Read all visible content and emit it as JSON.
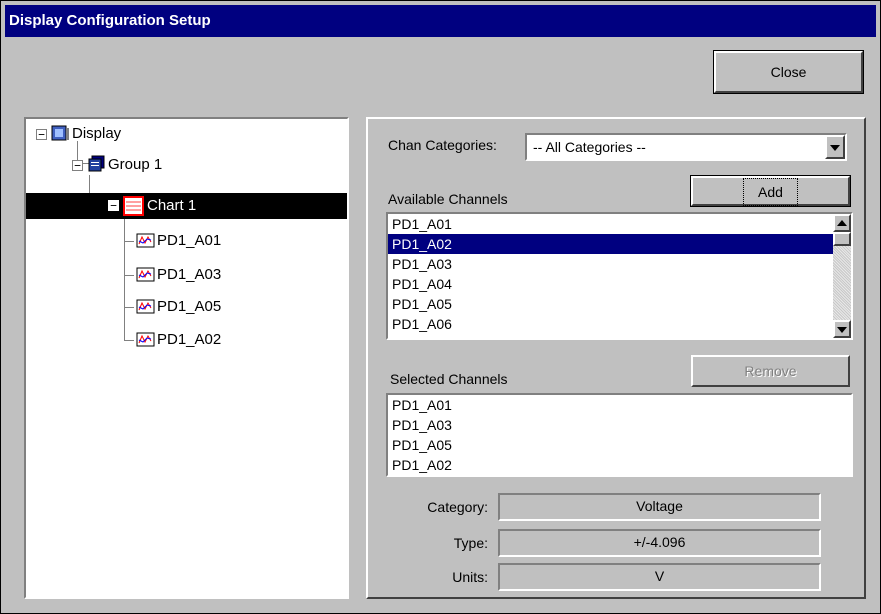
{
  "window": {
    "title": "Display Configuration Setup"
  },
  "close_button": {
    "label": "Close"
  },
  "tree": {
    "root": "Display",
    "group": "Group 1",
    "chart": "Chart 1",
    "channels": [
      "PD1_A01",
      "PD1_A03",
      "PD1_A05",
      "PD1_A02"
    ],
    "root_expander": "−",
    "group_expander": "−",
    "chart_expander": "−"
  },
  "panel": {
    "chan_categories_label": "Chan Categories:",
    "chan_categories_value": "-- All Categories --",
    "available_label": "Available Channels",
    "add_label": "Add",
    "available_channels": [
      "PD1_A01",
      "PD1_A02",
      "PD1_A03",
      "PD1_A04",
      "PD1_A05",
      "PD1_A06"
    ],
    "available_selected": "PD1_A02",
    "selected_label": "Selected Channels",
    "remove_label": "Remove",
    "selected_channels": [
      "PD1_A01",
      "PD1_A03",
      "PD1_A05",
      "PD1_A02"
    ],
    "category_label": "Category:",
    "category_value": "Voltage",
    "type_label": "Type:",
    "type_value": "+/-4.096",
    "units_label": "Units:",
    "units_value": "V"
  },
  "colors": {
    "title_bar": "#000080",
    "selection": "#000080",
    "face": "#c0c0c0"
  },
  "icons": [
    "display-icon",
    "group-icon",
    "chart-icon",
    "channel-icon"
  ]
}
